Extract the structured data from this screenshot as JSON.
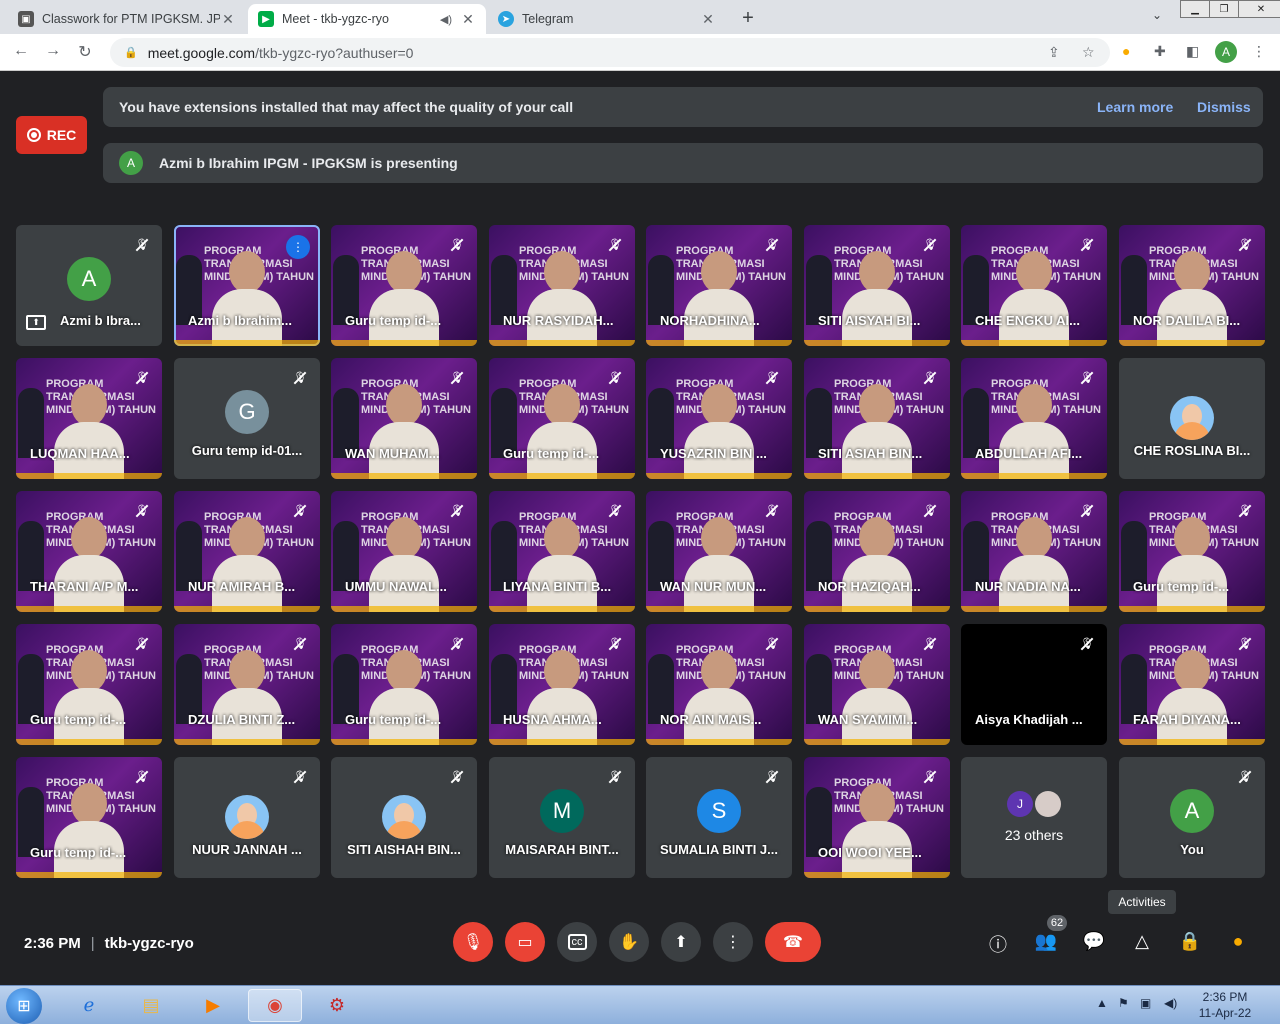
{
  "browser": {
    "tabs": [
      {
        "label": "Classwork for PTM IPGKSM. JPNJ",
        "icon": "classroom-icon",
        "active": false
      },
      {
        "label": "Meet - tkb-ygzc-ryo",
        "icon": "meet-icon",
        "active": true
      },
      {
        "label": "Telegram",
        "icon": "telegram-icon",
        "active": false
      }
    ],
    "url_host": "meet.google.com",
    "url_path": "/tkb-ygzc-ryo?authuser=0",
    "profile_initial": "A"
  },
  "meet": {
    "rec_label": "REC",
    "extension_banner": {
      "text": "You have extensions installed that may affect the quality of your call",
      "learn_more": "Learn more",
      "dismiss": "Dismiss"
    },
    "presenting_banner": {
      "initial": "A",
      "text": "Azmi b Ibrahim IPGM - IPGKSM is presenting"
    },
    "tiles": [
      {
        "name": "Azmi b Ibra...",
        "type": "avatar",
        "initial": "A",
        "color": "#43a047",
        "muted": true,
        "presenting": true
      },
      {
        "name": "Azmi b Ibrahim...",
        "type": "video",
        "speaking": true
      },
      {
        "name": "Guru temp id-...",
        "type": "video",
        "muted": true
      },
      {
        "name": "NUR RASYIDAH...",
        "type": "video",
        "muted": true
      },
      {
        "name": "NORHADHINA...",
        "type": "video",
        "muted": true
      },
      {
        "name": "SITI AISYAH BI...",
        "type": "video",
        "muted": true
      },
      {
        "name": "CHE ENGKU AI...",
        "type": "video",
        "muted": true
      },
      {
        "name": "NOR DALILA BI...",
        "type": "video",
        "muted": true
      },
      {
        "name": "LUQMAN HAA...",
        "type": "video",
        "muted": true
      },
      {
        "name": "Guru temp id-01...",
        "type": "avatar",
        "initial": "G",
        "color": "#78909c",
        "muted": true
      },
      {
        "name": "WAN MUHAM...",
        "type": "video",
        "muted": true
      },
      {
        "name": "Guru temp id-...",
        "type": "video",
        "muted": true
      },
      {
        "name": "YUSAZRIN BIN ...",
        "type": "video",
        "muted": true
      },
      {
        "name": "SITI ASIAH BIN...",
        "type": "video",
        "muted": true
      },
      {
        "name": "ABDULLAH AFI...",
        "type": "video",
        "muted": true
      },
      {
        "name": "CHE ROSLINA BI...",
        "type": "picture",
        "muted": false
      },
      {
        "name": "THARANI A/P M...",
        "type": "video",
        "muted": true
      },
      {
        "name": "NUR AMIRAH B...",
        "type": "video",
        "muted": true
      },
      {
        "name": "UMMU NAWAL...",
        "type": "video",
        "muted": true
      },
      {
        "name": "LIYANA BINTI B...",
        "type": "video",
        "muted": true
      },
      {
        "name": "WAN NUR MUN...",
        "type": "video",
        "muted": true
      },
      {
        "name": "NOR HAZIQAH...",
        "type": "video",
        "muted": true
      },
      {
        "name": "NUR NADIA NA...",
        "type": "video",
        "muted": true
      },
      {
        "name": "Guru temp id-...",
        "type": "video",
        "muted": true
      },
      {
        "name": "Guru temp id-...",
        "type": "video",
        "muted": true
      },
      {
        "name": "DZULIA BINTI Z...",
        "type": "video",
        "muted": true
      },
      {
        "name": "Guru temp id-...",
        "type": "video",
        "muted": true
      },
      {
        "name": "HUSNA AHMA...",
        "type": "video",
        "muted": true
      },
      {
        "name": "NOR AIN MAIS...",
        "type": "video",
        "muted": true
      },
      {
        "name": "WAN SYAMIMI...",
        "type": "video",
        "muted": true
      },
      {
        "name": "Aisya Khadijah ...",
        "type": "black",
        "muted": true
      },
      {
        "name": "FARAH DIYANA...",
        "type": "video",
        "muted": true
      },
      {
        "name": "Guru temp id-...",
        "type": "video",
        "muted": true
      },
      {
        "name": "NUUR JANNAH ...",
        "type": "picture",
        "muted": true
      },
      {
        "name": "SITI AISHAH BIN...",
        "type": "picture",
        "muted": true
      },
      {
        "name": "MAISARAH BINT...",
        "type": "avatar",
        "initial": "M",
        "color": "#00695c",
        "muted": true
      },
      {
        "name": "SUMALIA BINTI J...",
        "type": "avatar",
        "initial": "S",
        "color": "#1e88e5",
        "muted": true
      },
      {
        "name": "OOI WOOI YEE...",
        "type": "video",
        "muted": true
      },
      {
        "name": "23 others",
        "type": "others",
        "initial": "J",
        "color": "#5e35b1"
      },
      {
        "name": "You",
        "type": "avatar",
        "initial": "A",
        "color": "#43a047",
        "muted": true
      }
    ],
    "time": "2:36 PM",
    "meeting_code": "tkb-ygzc-ryo",
    "participants_count": "62",
    "tooltip": "Activities"
  },
  "taskbar": {
    "time": "2:36 PM",
    "date": "11-Apr-22"
  }
}
